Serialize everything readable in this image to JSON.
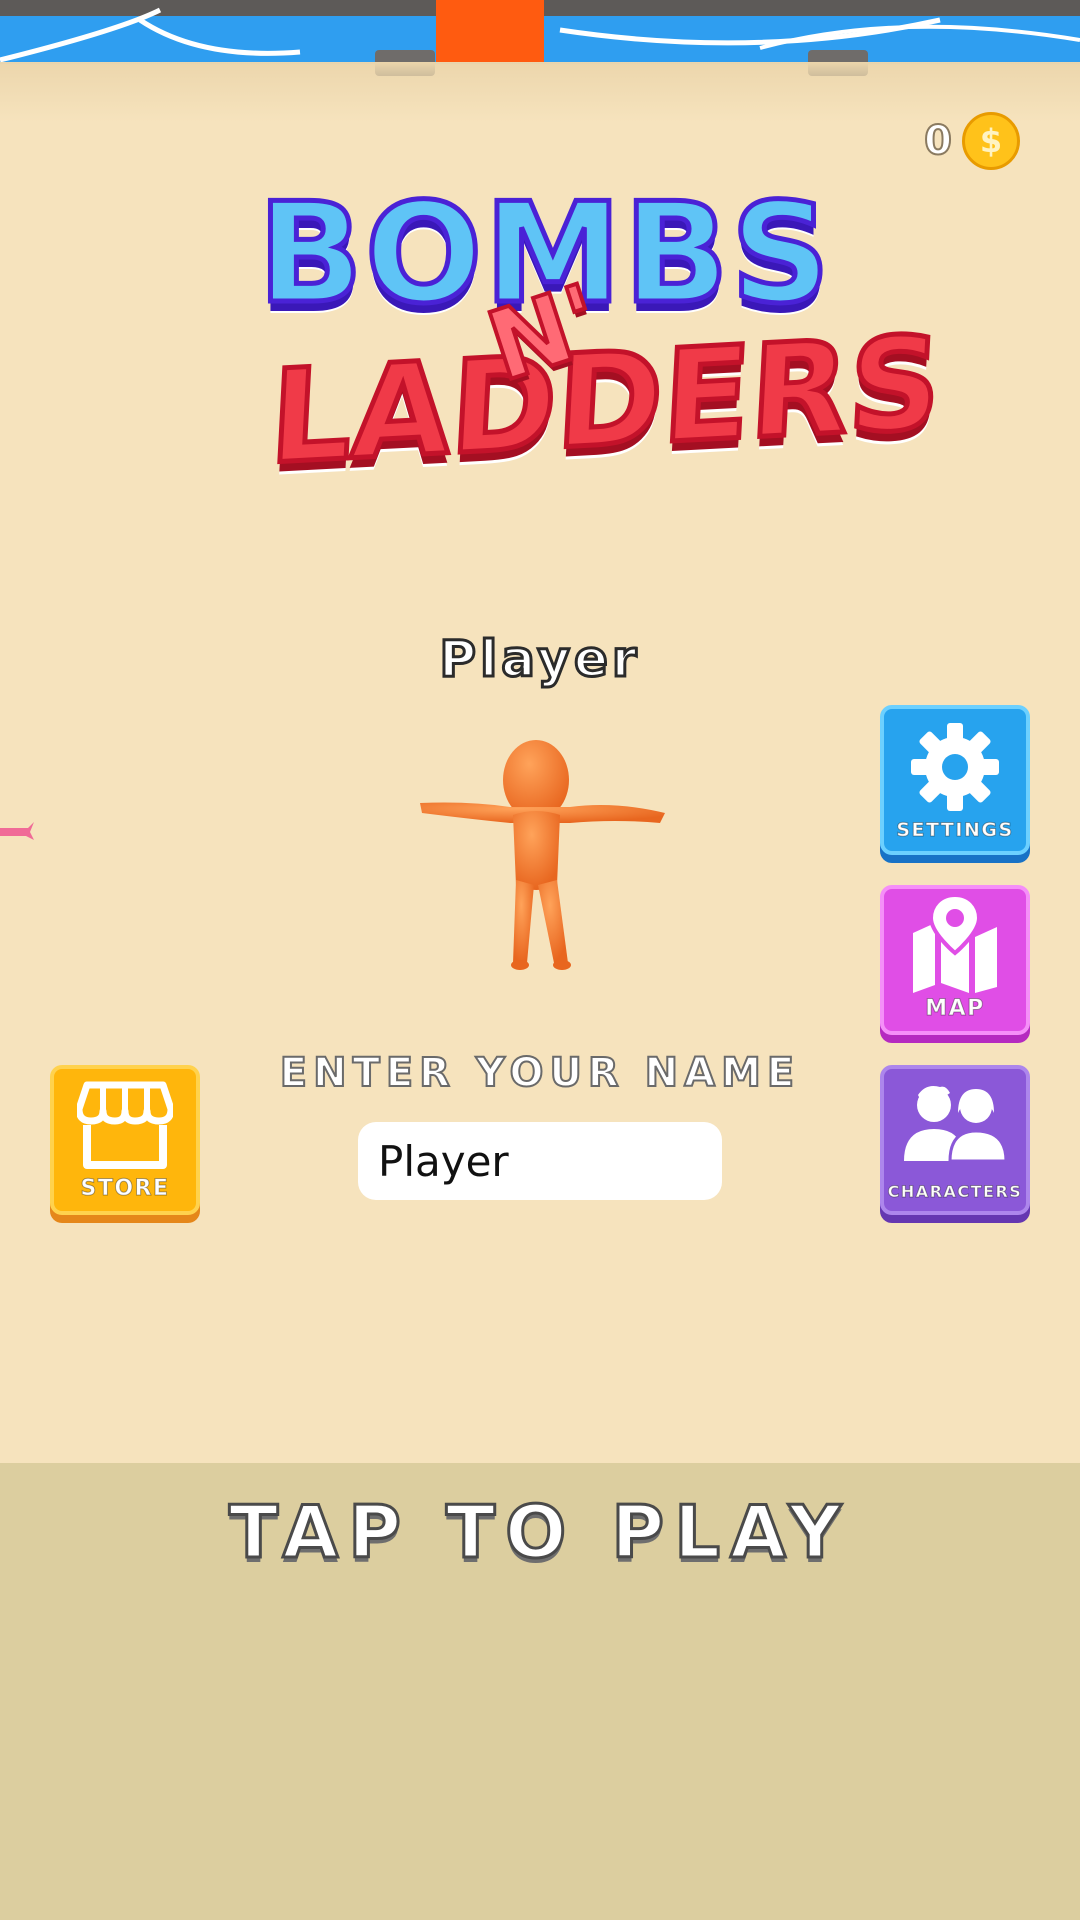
{
  "coins": {
    "count": "0",
    "icon": "$"
  },
  "logo": {
    "line1": "BOMBS",
    "middle": "N'",
    "line2": "LADDERS"
  },
  "player": {
    "display_name": "Player"
  },
  "buttons": {
    "settings_label": "SETTINGS",
    "map_label": "MAP",
    "characters_label": "CHARACTERS",
    "store_label": "STORE"
  },
  "name_entry": {
    "label": "ENTER YOUR NAME",
    "value": "Player"
  },
  "play": {
    "label": "TAP TO PLAY"
  },
  "colors": {
    "background": "#f6e3bd",
    "settings": "#27a3ee",
    "map": "#e04ee6",
    "characters": "#8b58d8",
    "store": "#ffb60c",
    "character": "#f07a2e",
    "bottom_panel": "#dcce9f"
  },
  "icons": {
    "settings": "gear-icon",
    "map": "map-pin-icon",
    "characters": "people-icon",
    "store": "storefront-icon",
    "coin": "coin-icon"
  }
}
